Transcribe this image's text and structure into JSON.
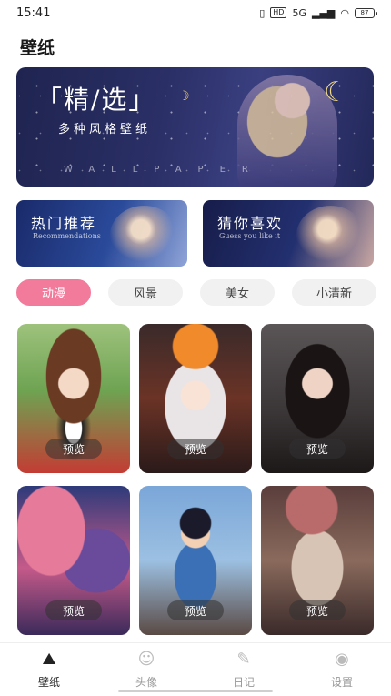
{
  "status_bar": {
    "time": "15:41",
    "network": "5G",
    "hd": "HD",
    "battery": "87"
  },
  "page": {
    "title": "壁纸"
  },
  "hero": {
    "title": "「精/选」",
    "subtitle": "多种风格壁纸",
    "en": "WALLPAPER"
  },
  "cards": [
    {
      "title": "热门推荐",
      "en": "Recommendations"
    },
    {
      "title": "猜你喜欢",
      "en": "Guess you like it"
    }
  ],
  "tabs": [
    {
      "label": "动漫",
      "active": true
    },
    {
      "label": "风景",
      "active": false
    },
    {
      "label": "美女",
      "active": false
    },
    {
      "label": "小清新",
      "active": false
    }
  ],
  "grid": {
    "preview_label": "预览"
  },
  "bottom_nav": [
    {
      "label": "壁纸",
      "icon": "mountain-icon",
      "active": true
    },
    {
      "label": "头像",
      "icon": "smile-icon",
      "active": false
    },
    {
      "label": "日记",
      "icon": "pen-icon",
      "active": false
    },
    {
      "label": "设置",
      "icon": "eye-icon",
      "active": false
    }
  ],
  "colors": {
    "accent": "#f27a9b"
  }
}
